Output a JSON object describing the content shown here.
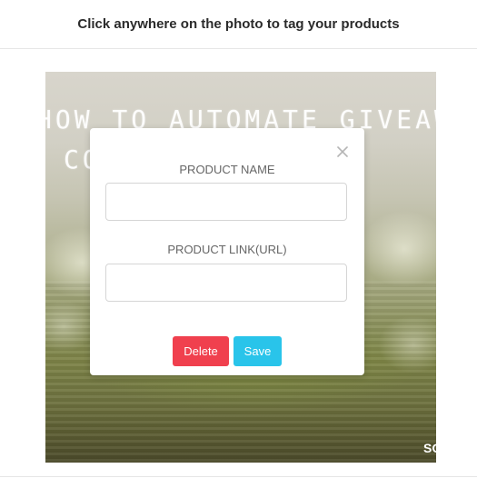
{
  "header": {
    "title": "Click anywhere on the photo to tag your products"
  },
  "photo": {
    "overlay_line_1": "HOW TO AUTOMATE GIVEAWAYS",
    "overlay_line_2": "CO                     AM?",
    "corner_text": "SO"
  },
  "modal": {
    "close_icon": "close-icon",
    "product_name_label": "PRODUCT NAME",
    "product_name_value": "",
    "product_link_label": "PRODUCT LINK(URL)",
    "product_link_value": "",
    "delete_label": "Delete",
    "save_label": "Save",
    "delete_color": "#f0404e",
    "save_color": "#29c4ea"
  }
}
